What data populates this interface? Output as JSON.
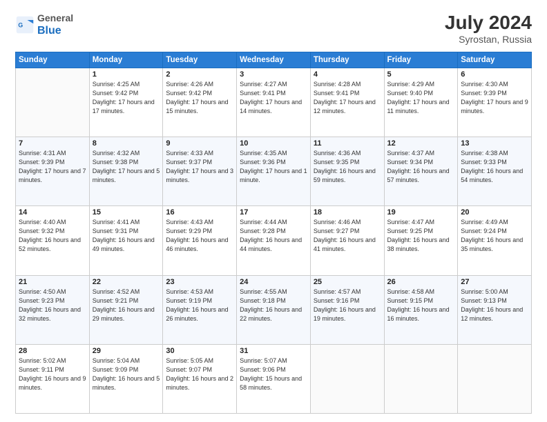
{
  "header": {
    "logo_general": "General",
    "logo_blue": "Blue",
    "month_year": "July 2024",
    "location": "Syrostan, Russia"
  },
  "days_of_week": [
    "Sunday",
    "Monday",
    "Tuesday",
    "Wednesday",
    "Thursday",
    "Friday",
    "Saturday"
  ],
  "weeks": [
    [
      {
        "day": "",
        "empty": true
      },
      {
        "day": "1",
        "sunrise": "Sunrise: 4:25 AM",
        "sunset": "Sunset: 9:42 PM",
        "daylight": "Daylight: 17 hours and 17 minutes."
      },
      {
        "day": "2",
        "sunrise": "Sunrise: 4:26 AM",
        "sunset": "Sunset: 9:42 PM",
        "daylight": "Daylight: 17 hours and 15 minutes."
      },
      {
        "day": "3",
        "sunrise": "Sunrise: 4:27 AM",
        "sunset": "Sunset: 9:41 PM",
        "daylight": "Daylight: 17 hours and 14 minutes."
      },
      {
        "day": "4",
        "sunrise": "Sunrise: 4:28 AM",
        "sunset": "Sunset: 9:41 PM",
        "daylight": "Daylight: 17 hours and 12 minutes."
      },
      {
        "day": "5",
        "sunrise": "Sunrise: 4:29 AM",
        "sunset": "Sunset: 9:40 PM",
        "daylight": "Daylight: 17 hours and 11 minutes."
      },
      {
        "day": "6",
        "sunrise": "Sunrise: 4:30 AM",
        "sunset": "Sunset: 9:39 PM",
        "daylight": "Daylight: 17 hours and 9 minutes."
      }
    ],
    [
      {
        "day": "7",
        "sunrise": "Sunrise: 4:31 AM",
        "sunset": "Sunset: 9:39 PM",
        "daylight": "Daylight: 17 hours and 7 minutes."
      },
      {
        "day": "8",
        "sunrise": "Sunrise: 4:32 AM",
        "sunset": "Sunset: 9:38 PM",
        "daylight": "Daylight: 17 hours and 5 minutes."
      },
      {
        "day": "9",
        "sunrise": "Sunrise: 4:33 AM",
        "sunset": "Sunset: 9:37 PM",
        "daylight": "Daylight: 17 hours and 3 minutes."
      },
      {
        "day": "10",
        "sunrise": "Sunrise: 4:35 AM",
        "sunset": "Sunset: 9:36 PM",
        "daylight": "Daylight: 17 hours and 1 minute."
      },
      {
        "day": "11",
        "sunrise": "Sunrise: 4:36 AM",
        "sunset": "Sunset: 9:35 PM",
        "daylight": "Daylight: 16 hours and 59 minutes."
      },
      {
        "day": "12",
        "sunrise": "Sunrise: 4:37 AM",
        "sunset": "Sunset: 9:34 PM",
        "daylight": "Daylight: 16 hours and 57 minutes."
      },
      {
        "day": "13",
        "sunrise": "Sunrise: 4:38 AM",
        "sunset": "Sunset: 9:33 PM",
        "daylight": "Daylight: 16 hours and 54 minutes."
      }
    ],
    [
      {
        "day": "14",
        "sunrise": "Sunrise: 4:40 AM",
        "sunset": "Sunset: 9:32 PM",
        "daylight": "Daylight: 16 hours and 52 minutes."
      },
      {
        "day": "15",
        "sunrise": "Sunrise: 4:41 AM",
        "sunset": "Sunset: 9:31 PM",
        "daylight": "Daylight: 16 hours and 49 minutes."
      },
      {
        "day": "16",
        "sunrise": "Sunrise: 4:43 AM",
        "sunset": "Sunset: 9:29 PM",
        "daylight": "Daylight: 16 hours and 46 minutes."
      },
      {
        "day": "17",
        "sunrise": "Sunrise: 4:44 AM",
        "sunset": "Sunset: 9:28 PM",
        "daylight": "Daylight: 16 hours and 44 minutes."
      },
      {
        "day": "18",
        "sunrise": "Sunrise: 4:46 AM",
        "sunset": "Sunset: 9:27 PM",
        "daylight": "Daylight: 16 hours and 41 minutes."
      },
      {
        "day": "19",
        "sunrise": "Sunrise: 4:47 AM",
        "sunset": "Sunset: 9:25 PM",
        "daylight": "Daylight: 16 hours and 38 minutes."
      },
      {
        "day": "20",
        "sunrise": "Sunrise: 4:49 AM",
        "sunset": "Sunset: 9:24 PM",
        "daylight": "Daylight: 16 hours and 35 minutes."
      }
    ],
    [
      {
        "day": "21",
        "sunrise": "Sunrise: 4:50 AM",
        "sunset": "Sunset: 9:23 PM",
        "daylight": "Daylight: 16 hours and 32 minutes."
      },
      {
        "day": "22",
        "sunrise": "Sunrise: 4:52 AM",
        "sunset": "Sunset: 9:21 PM",
        "daylight": "Daylight: 16 hours and 29 minutes."
      },
      {
        "day": "23",
        "sunrise": "Sunrise: 4:53 AM",
        "sunset": "Sunset: 9:19 PM",
        "daylight": "Daylight: 16 hours and 26 minutes."
      },
      {
        "day": "24",
        "sunrise": "Sunrise: 4:55 AM",
        "sunset": "Sunset: 9:18 PM",
        "daylight": "Daylight: 16 hours and 22 minutes."
      },
      {
        "day": "25",
        "sunrise": "Sunrise: 4:57 AM",
        "sunset": "Sunset: 9:16 PM",
        "daylight": "Daylight: 16 hours and 19 minutes."
      },
      {
        "day": "26",
        "sunrise": "Sunrise: 4:58 AM",
        "sunset": "Sunset: 9:15 PM",
        "daylight": "Daylight: 16 hours and 16 minutes."
      },
      {
        "day": "27",
        "sunrise": "Sunrise: 5:00 AM",
        "sunset": "Sunset: 9:13 PM",
        "daylight": "Daylight: 16 hours and 12 minutes."
      }
    ],
    [
      {
        "day": "28",
        "sunrise": "Sunrise: 5:02 AM",
        "sunset": "Sunset: 9:11 PM",
        "daylight": "Daylight: 16 hours and 9 minutes."
      },
      {
        "day": "29",
        "sunrise": "Sunrise: 5:04 AM",
        "sunset": "Sunset: 9:09 PM",
        "daylight": "Daylight: 16 hours and 5 minutes."
      },
      {
        "day": "30",
        "sunrise": "Sunrise: 5:05 AM",
        "sunset": "Sunset: 9:07 PM",
        "daylight": "Daylight: 16 hours and 2 minutes."
      },
      {
        "day": "31",
        "sunrise": "Sunrise: 5:07 AM",
        "sunset": "Sunset: 9:06 PM",
        "daylight": "Daylight: 15 hours and 58 minutes."
      },
      {
        "day": "",
        "empty": true
      },
      {
        "day": "",
        "empty": true
      },
      {
        "day": "",
        "empty": true
      }
    ]
  ]
}
